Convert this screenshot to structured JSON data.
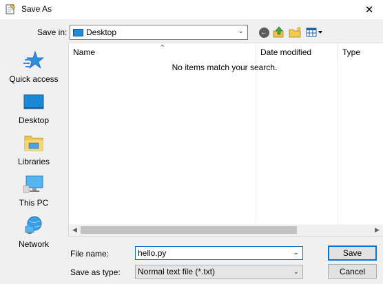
{
  "window": {
    "title": "Save As",
    "close_glyph": "✕",
    "icon": "notepad-icon"
  },
  "toolbar": {
    "save_in_label": "Save in:",
    "save_in_value": "Desktop",
    "icons": [
      "back-icon",
      "up-folder-icon",
      "new-folder-icon",
      "view-menu-icon"
    ]
  },
  "places": [
    {
      "label": "Quick access",
      "icon": "star-icon"
    },
    {
      "label": "Desktop",
      "icon": "desktop-icon"
    },
    {
      "label": "Libraries",
      "icon": "libraries-icon"
    },
    {
      "label": "This PC",
      "icon": "computer-icon"
    },
    {
      "label": "Network",
      "icon": "network-icon"
    }
  ],
  "filelist": {
    "columns": [
      "Name",
      "Date modified",
      "Type"
    ],
    "empty_message": "No items match your search."
  },
  "form": {
    "file_name_label": "File name:",
    "file_name_value": "hello.py",
    "save_as_type_label": "Save as type:",
    "save_as_type_value": "Normal text file (*.txt)"
  },
  "buttons": {
    "save": "Save",
    "cancel": "Cancel"
  },
  "colors": {
    "accent": "#0078d7",
    "folder_blue": "#1f8ad8",
    "star_blue": "#2e8fe0",
    "dialog_bg": "#f0f0f0"
  }
}
